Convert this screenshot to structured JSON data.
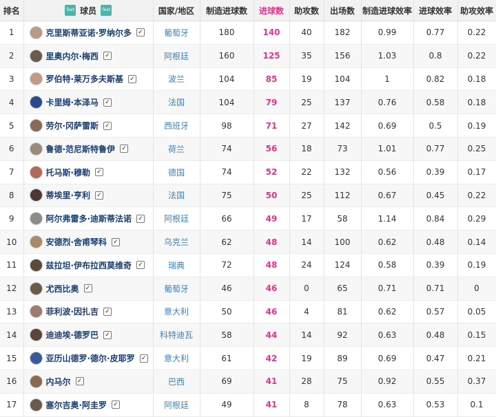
{
  "headers": {
    "rank": "排名",
    "player": "球员",
    "country": "国家/地区",
    "created": "制造进球数",
    "goals": "进球数",
    "assists": "助攻数",
    "apps": "出场数",
    "created_eff": "制造进球效率",
    "goal_eff": "进球效率",
    "assist_eff": "助攻效率",
    "tool_left": "Text",
    "tool_right": "Text"
  },
  "colors": {
    "accent": "#e6318e",
    "country_link": "#3b83c0",
    "header_bg": "#f2f2f2",
    "tool_button": "#4fb3a9"
  },
  "check_glyph": "✓",
  "rows": [
    {
      "rank": "1",
      "player": "克里斯蒂亚诺·罗纳尔多",
      "country": "葡萄牙",
      "created": "180",
      "goals": "140",
      "assists": "40",
      "apps": "182",
      "created_eff": "0.99",
      "goal_eff": "0.77",
      "assist_eff": "0.22",
      "avatar": "#b89a86"
    },
    {
      "rank": "2",
      "player": "里奥内尔·梅西",
      "country": "阿根廷",
      "created": "160",
      "goals": "125",
      "assists": "35",
      "apps": "156",
      "created_eff": "1.03",
      "goal_eff": "0.8",
      "assist_eff": "0.22",
      "avatar": "#6a5a4e"
    },
    {
      "rank": "3",
      "player": "罗伯特·莱万多夫斯基",
      "country": "波兰",
      "created": "104",
      "goals": "85",
      "assists": "19",
      "apps": "104",
      "created_eff": "1",
      "goal_eff": "0.82",
      "assist_eff": "0.18",
      "avatar": "#c49a86"
    },
    {
      "rank": "4",
      "player": "卡里姆·本泽马",
      "country": "法国",
      "created": "104",
      "goals": "79",
      "assists": "25",
      "apps": "137",
      "created_eff": "0.76",
      "goal_eff": "0.58",
      "assist_eff": "0.18",
      "avatar": "#2c4a8a"
    },
    {
      "rank": "5",
      "player": "劳尔·冈萨雷斯",
      "country": "西班牙",
      "created": "98",
      "goals": "71",
      "assists": "27",
      "apps": "142",
      "created_eff": "0.69",
      "goal_eff": "0.5",
      "assist_eff": "0.19",
      "avatar": "#8a6a56"
    },
    {
      "rank": "6",
      "player": "鲁德·范尼斯特鲁伊",
      "country": "荷兰",
      "created": "74",
      "goals": "56",
      "assists": "18",
      "apps": "73",
      "created_eff": "1.01",
      "goal_eff": "0.77",
      "assist_eff": "0.25",
      "avatar": "#9a8a7a"
    },
    {
      "rank": "7",
      "player": "托马斯·穆勒",
      "country": "德国",
      "created": "74",
      "goals": "52",
      "assists": "22",
      "apps": "132",
      "created_eff": "0.56",
      "goal_eff": "0.39",
      "assist_eff": "0.17",
      "avatar": "#b06a5a"
    },
    {
      "rank": "8",
      "player": "蒂埃里·亨利",
      "country": "法国",
      "created": "75",
      "goals": "50",
      "assists": "25",
      "apps": "112",
      "created_eff": "0.67",
      "goal_eff": "0.45",
      "assist_eff": "0.22",
      "avatar": "#4a3a32"
    },
    {
      "rank": "9",
      "player": "阿尔弗雷多·迪斯蒂法诺",
      "country": "阿根廷",
      "created": "66",
      "goals": "49",
      "assists": "17",
      "apps": "58",
      "created_eff": "1.14",
      "goal_eff": "0.84",
      "assist_eff": "0.29",
      "avatar": "#8c8c8c"
    },
    {
      "rank": "10",
      "player": "安德烈·舍甫琴科",
      "country": "乌克兰",
      "created": "62",
      "goals": "48",
      "assists": "14",
      "apps": "100",
      "created_eff": "0.62",
      "goal_eff": "0.48",
      "assist_eff": "0.14",
      "avatar": "#a88a6a"
    },
    {
      "rank": "11",
      "player": "兹拉坦·伊布拉西莫维奇",
      "country": "瑞典",
      "created": "72",
      "goals": "48",
      "assists": "24",
      "apps": "124",
      "created_eff": "0.58",
      "goal_eff": "0.39",
      "assist_eff": "0.19",
      "avatar": "#5a4a3a"
    },
    {
      "rank": "12",
      "player": "尤西比奥",
      "country": "葡萄牙",
      "created": "46",
      "goals": "46",
      "assists": "0",
      "apps": "65",
      "created_eff": "0.71",
      "goal_eff": "0.71",
      "assist_eff": "0",
      "avatar": "#6a5a4a"
    },
    {
      "rank": "13",
      "player": "菲利波·因扎吉",
      "country": "意大利",
      "created": "50",
      "goals": "46",
      "assists": "4",
      "apps": "81",
      "created_eff": "0.62",
      "goal_eff": "0.57",
      "assist_eff": "0.05",
      "avatar": "#a07a6a"
    },
    {
      "rank": "14",
      "player": "迪迪埃·德罗巴",
      "country": "科特迪瓦",
      "created": "58",
      "goals": "44",
      "assists": "14",
      "apps": "92",
      "created_eff": "0.63",
      "goal_eff": "0.48",
      "assist_eff": "0.15",
      "avatar": "#5a4636"
    },
    {
      "rank": "15",
      "player": "亚历山德罗·德尔·皮耶罗",
      "country": "意大利",
      "created": "61",
      "goals": "42",
      "assists": "19",
      "apps": "89",
      "created_eff": "0.69",
      "goal_eff": "0.47",
      "assist_eff": "0.21",
      "avatar": "#3a5a9a"
    },
    {
      "rank": "16",
      "player": "内马尔",
      "country": "巴西",
      "created": "69",
      "goals": "41",
      "assists": "28",
      "apps": "75",
      "created_eff": "0.92",
      "goal_eff": "0.55",
      "assist_eff": "0.37",
      "avatar": "#8a6a4e"
    },
    {
      "rank": "17",
      "player": "塞尔吉奥·阿圭罗",
      "country": "阿根廷",
      "created": "49",
      "goals": "41",
      "assists": "8",
      "apps": "78",
      "created_eff": "0.63",
      "goal_eff": "0.53",
      "assist_eff": "0.1",
      "avatar": "#6a5a4a"
    }
  ]
}
